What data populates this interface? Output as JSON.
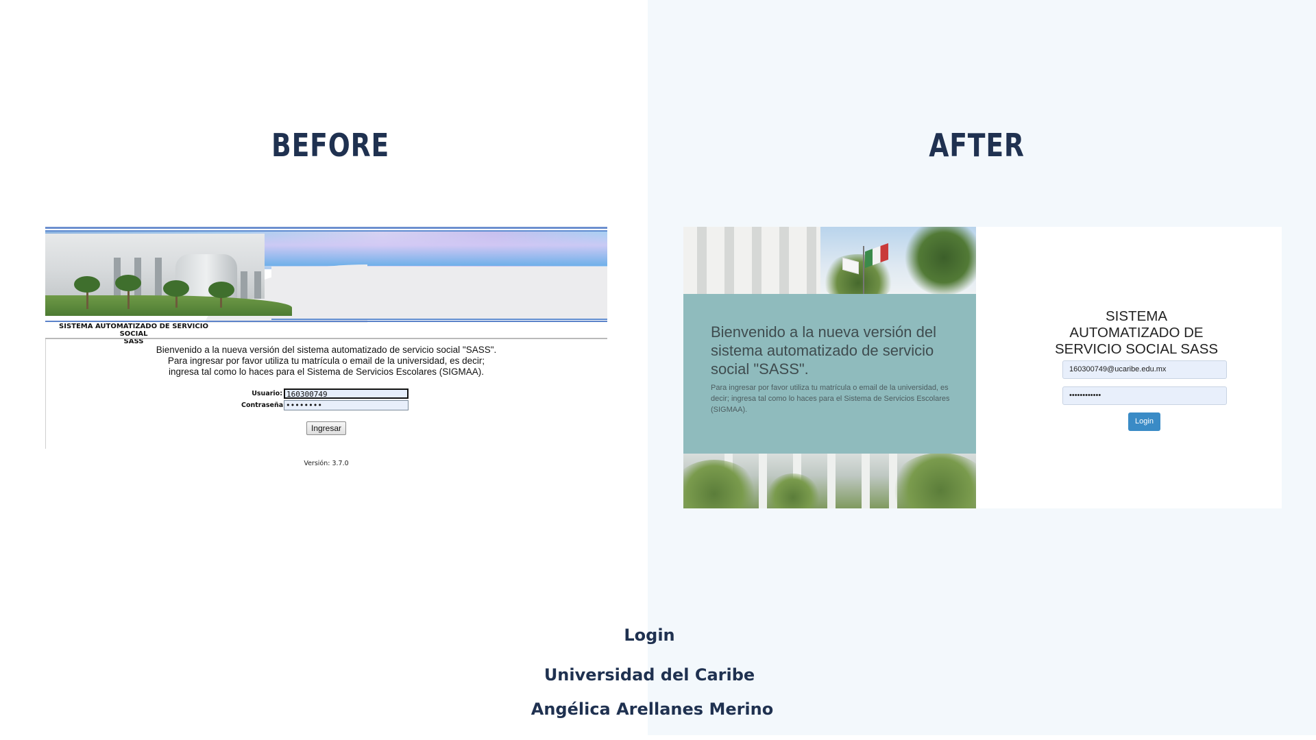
{
  "headings": {
    "before": "BEFORE",
    "after": "AFTER"
  },
  "before": {
    "system_title_line1": "SISTEMA AUTOMATIZADO DE SERVICIO SOCIAL",
    "system_title_line2": "SASS",
    "welcome_line1": "Bienvenido a la nueva versión del sistema automatizado de servicio social \"SASS\".",
    "welcome_line2": "Para ingresar por favor utiliza tu matrícula o email de la universidad, es decir;",
    "welcome_line3": "ingresa tal como lo haces para el Sistema de Servicios Escolares (SIGMAA).",
    "user_label": "Usuario:",
    "user_value": "160300749",
    "password_label": "Contraseña:",
    "password_value": "••••••••",
    "submit_label": "Ingresar",
    "version": "Versión: 3.7.0"
  },
  "after": {
    "welcome": "Bienvenido a la nueva versión del sistema automatizado de servicio social \"SASS\".",
    "instructions": "Para ingresar por favor utiliza tu matrícula o email de la universidad, es decir; ingresa tal como lo haces para el Sistema de Servicios Escolares (SIGMAA).",
    "title_line1": "SISTEMA",
    "title_line2": "AUTOMATIZADO DE",
    "title_line3": "SERVICIO SOCIAL SASS",
    "email_value": "160300749@ucaribe.edu.mx",
    "password_value": "••••••••••••",
    "login_label": "Login"
  },
  "captions": {
    "screen": "Login",
    "organization": "Universidad del Caribe",
    "author": "Angélica Arellanes Merino"
  },
  "colors": {
    "heading": "#1f3150",
    "after_background": "#f3f8fc",
    "welcome_panel": "#8fbbbd",
    "login_button": "#3a8bc6"
  }
}
